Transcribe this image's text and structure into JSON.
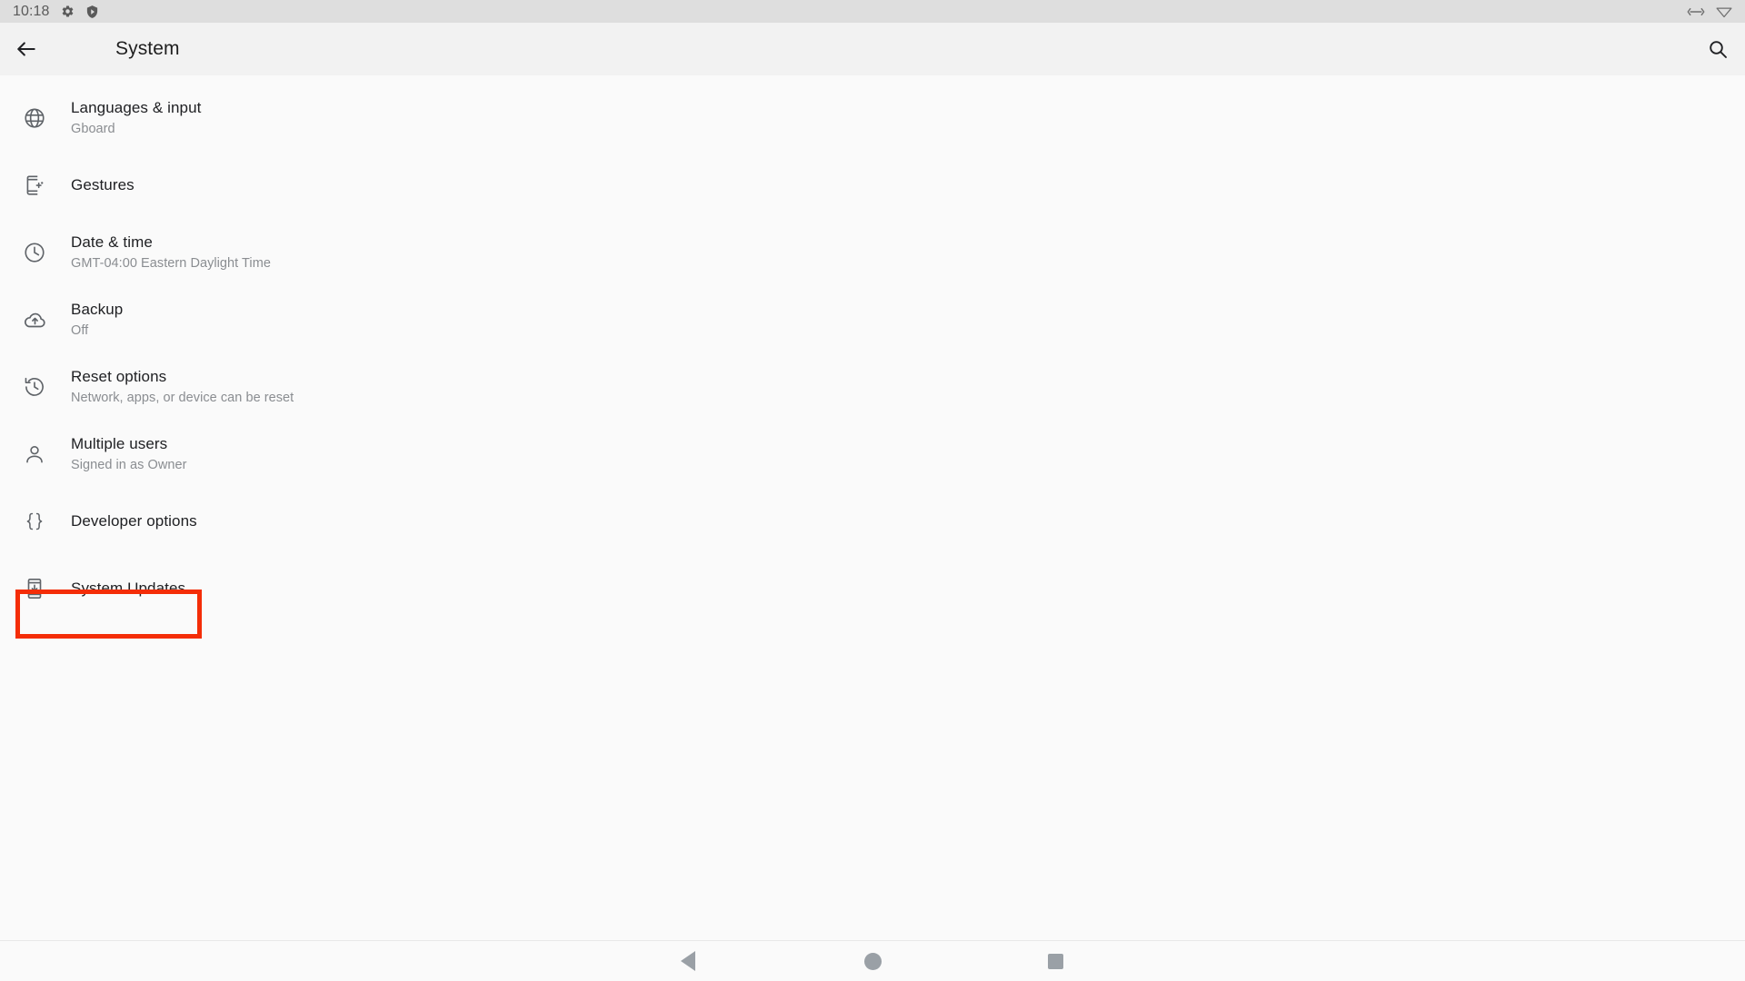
{
  "status_bar": {
    "time": "10:18",
    "left_icons": [
      {
        "name": "settings-gear-icon"
      },
      {
        "name": "play-protect-shield-icon"
      }
    ],
    "right_icons": [
      {
        "name": "ethernet-arrows-icon"
      },
      {
        "name": "wifi-icon"
      }
    ],
    "background_color": "#dedede"
  },
  "app_bar": {
    "back_label": "Back",
    "title": "System",
    "search_label": "Search settings",
    "background_color": "#f2f2f2"
  },
  "settings": {
    "items": [
      {
        "icon": "globe-icon",
        "title": "Languages & input",
        "subtitle": "Gboard"
      },
      {
        "icon": "gestures-phone-icon",
        "title": "Gestures",
        "subtitle": ""
      },
      {
        "icon": "clock-icon",
        "title": "Date & time",
        "subtitle": "GMT-04:00 Eastern Daylight Time"
      },
      {
        "icon": "cloud-upload-icon",
        "title": "Backup",
        "subtitle": "Off"
      },
      {
        "icon": "restore-history-icon",
        "title": "Reset options",
        "subtitle": "Network, apps, or device can be reset"
      },
      {
        "icon": "person-icon",
        "title": "Multiple users",
        "subtitle": "Signed in as Owner"
      },
      {
        "icon": "curly-braces-icon",
        "title": "Developer options",
        "subtitle": ""
      },
      {
        "icon": "system-update-icon",
        "title": "System Updates",
        "subtitle": ""
      }
    ]
  },
  "highlight": {
    "target": "System Updates",
    "color": "#f42d07"
  },
  "nav_bar": {
    "back_label": "Back",
    "home_label": "Home",
    "recents_label": "Recent apps"
  }
}
